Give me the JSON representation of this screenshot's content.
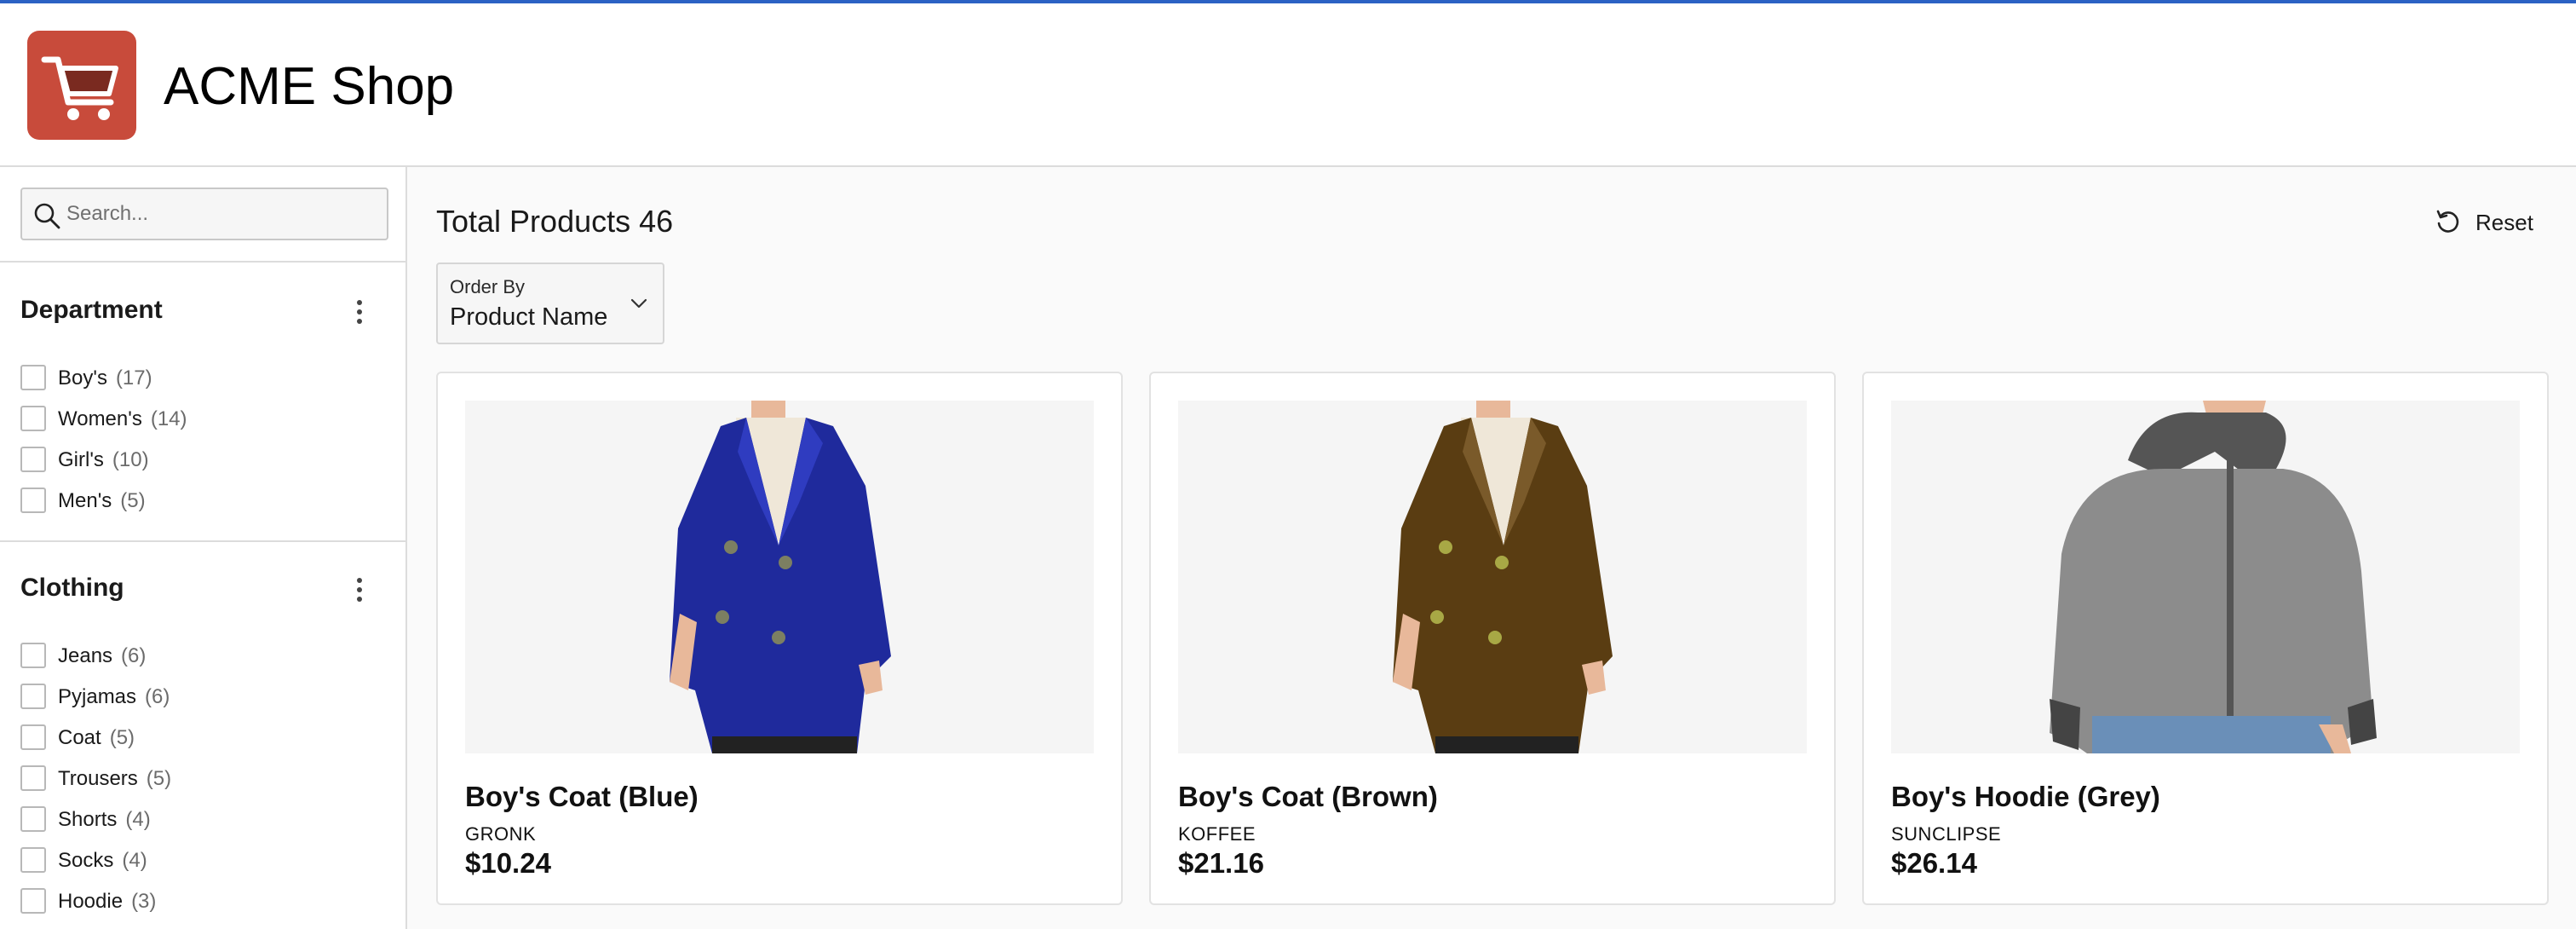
{
  "header": {
    "title": "ACME Shop",
    "logo_icon": "shopping-cart-icon",
    "logo_color": "#c84b3b"
  },
  "sidebar": {
    "search_placeholder": "Search...",
    "facets": [
      {
        "title": "Department",
        "options": [
          {
            "label": "Boy's",
            "count": "(17)"
          },
          {
            "label": "Women's",
            "count": "(14)"
          },
          {
            "label": "Girl's",
            "count": "(10)"
          },
          {
            "label": "Men's",
            "count": "(5)"
          }
        ]
      },
      {
        "title": "Clothing",
        "options": [
          {
            "label": "Jeans",
            "count": "(6)"
          },
          {
            "label": "Pyjamas",
            "count": "(6)"
          },
          {
            "label": "Coat",
            "count": "(5)"
          },
          {
            "label": "Trousers",
            "count": "(5)"
          },
          {
            "label": "Shorts",
            "count": "(4)"
          },
          {
            "label": "Socks",
            "count": "(4)"
          },
          {
            "label": "Hoodie",
            "count": "(3)"
          }
        ]
      }
    ]
  },
  "main": {
    "total_products": "Total Products 46",
    "reset_label": "Reset",
    "order_by": {
      "label": "Order By",
      "value": "Product Name"
    },
    "products": [
      {
        "name": "Boy's Coat (Blue)",
        "brand": "GRONK",
        "price": "$10.24",
        "image": "blue-coat-image"
      },
      {
        "name": "Boy's Coat (Brown)",
        "brand": "KOFFEE",
        "price": "$21.16",
        "image": "brown-coat-image"
      },
      {
        "name": "Boy's Hoodie (Grey)",
        "brand": "SUNCLIPSE",
        "price": "$26.14",
        "image": "grey-hoodie-image"
      }
    ]
  },
  "colors": {
    "accent": "#2b62c4",
    "blue_coat": "#1f2a9c",
    "brown_coat": "#5a3d12",
    "grey_hoodie": "#8c8c8c"
  }
}
